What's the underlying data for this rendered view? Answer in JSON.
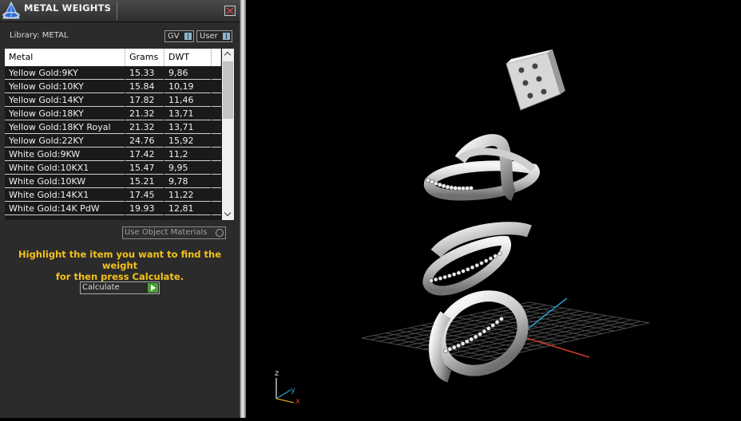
{
  "panel": {
    "title": "METAL WEIGHTS",
    "library_label": "Library: METAL",
    "toggles": [
      {
        "label": "GV"
      },
      {
        "label": "User"
      }
    ]
  },
  "table": {
    "columns": [
      "Metal",
      "Grams",
      "DWT"
    ],
    "rows": [
      {
        "metal": "Yellow Gold:9KY",
        "grams": "15.33",
        "dwt": "9,86"
      },
      {
        "metal": "Yellow Gold:10KY",
        "grams": "15.84",
        "dwt": "10,19"
      },
      {
        "metal": "Yellow Gold:14KY",
        "grams": "17.82",
        "dwt": "11,46"
      },
      {
        "metal": "Yellow Gold:18KY",
        "grams": "21.32",
        "dwt": "13,71"
      },
      {
        "metal": "Yellow Gold:18KY Royal",
        "grams": "21.32",
        "dwt": "13,71"
      },
      {
        "metal": "Yellow Gold:22KY",
        "grams": "24.76",
        "dwt": "15,92"
      },
      {
        "metal": "White Gold:9KW",
        "grams": "17.42",
        "dwt": "11,2"
      },
      {
        "metal": "White Gold:10KX1",
        "grams": "15.47",
        "dwt": "9,95"
      },
      {
        "metal": "White Gold:10KW",
        "grams": "15.21",
        "dwt": "9,78"
      },
      {
        "metal": "White Gold:14KX1",
        "grams": "17.45",
        "dwt": "11,22"
      },
      {
        "metal": "White Gold:14K PdW",
        "grams": "19.93",
        "dwt": "12,81"
      }
    ]
  },
  "controls": {
    "use_object_materials": "Use Object Materials",
    "instruction_line1": "Highlight the item you want to find the weight",
    "instruction_line2": "for then press Calculate.",
    "calculate_label": "Calculate"
  },
  "viewport": {
    "axis_labels": {
      "z": "z",
      "y": "y",
      "x": "x"
    }
  },
  "colors": {
    "instruction": "#f4c21a",
    "panel_bg": "#2b2b2b",
    "accent_green": "#49a135",
    "axis_x": "#d23a2a",
    "axis_y": "#2a9fd0"
  }
}
